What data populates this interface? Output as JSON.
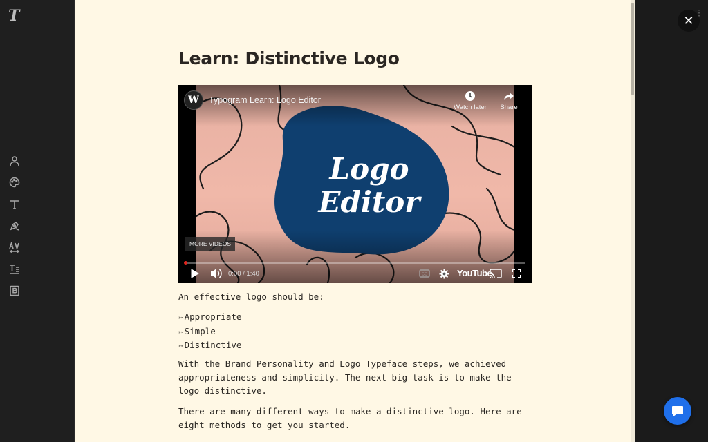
{
  "sidebar": {
    "logo": "T",
    "items": [
      {
        "icon": "person-icon"
      },
      {
        "icon": "palette-icon"
      },
      {
        "icon": "typeface-icon"
      },
      {
        "icon": "pen-tool-icon"
      },
      {
        "icon": "kerning-icon"
      },
      {
        "icon": "text-layout-icon"
      },
      {
        "icon": "brand-book-icon"
      }
    ]
  },
  "page": {
    "title": "Learn: Distinctive Logo",
    "close_label": "✕"
  },
  "video": {
    "channel_initial": "W",
    "title": "Typogram Learn: Logo Editor",
    "watch_later": "Watch later",
    "share": "Share",
    "thumbnail_text_line1": "Logo",
    "thumbnail_text_line2": "Editor",
    "more_videos": "MORE VIDEOS",
    "time": "0:00 / 1:40",
    "brand": "YouTube",
    "progress_fraction": 0.0
  },
  "body": {
    "intro": "An effective logo should be:",
    "bullets": [
      "Appropriate",
      "Simple",
      "Distinctive"
    ],
    "para1": "With the Brand Personality and Logo Typeface steps, we achieved appropriateness and simplicity. The next big task is to make the logo distinctive.",
    "para2": "There are many different ways to make a distinctive logo. Here are eight methods to get you started."
  },
  "colors": {
    "panel_bg": "#fff8e5",
    "chrome_bg": "#1f1f1f",
    "blob": "#0f3f6f",
    "thumb_bg": "#f0b8a9",
    "chat_button": "#1f6fea"
  }
}
